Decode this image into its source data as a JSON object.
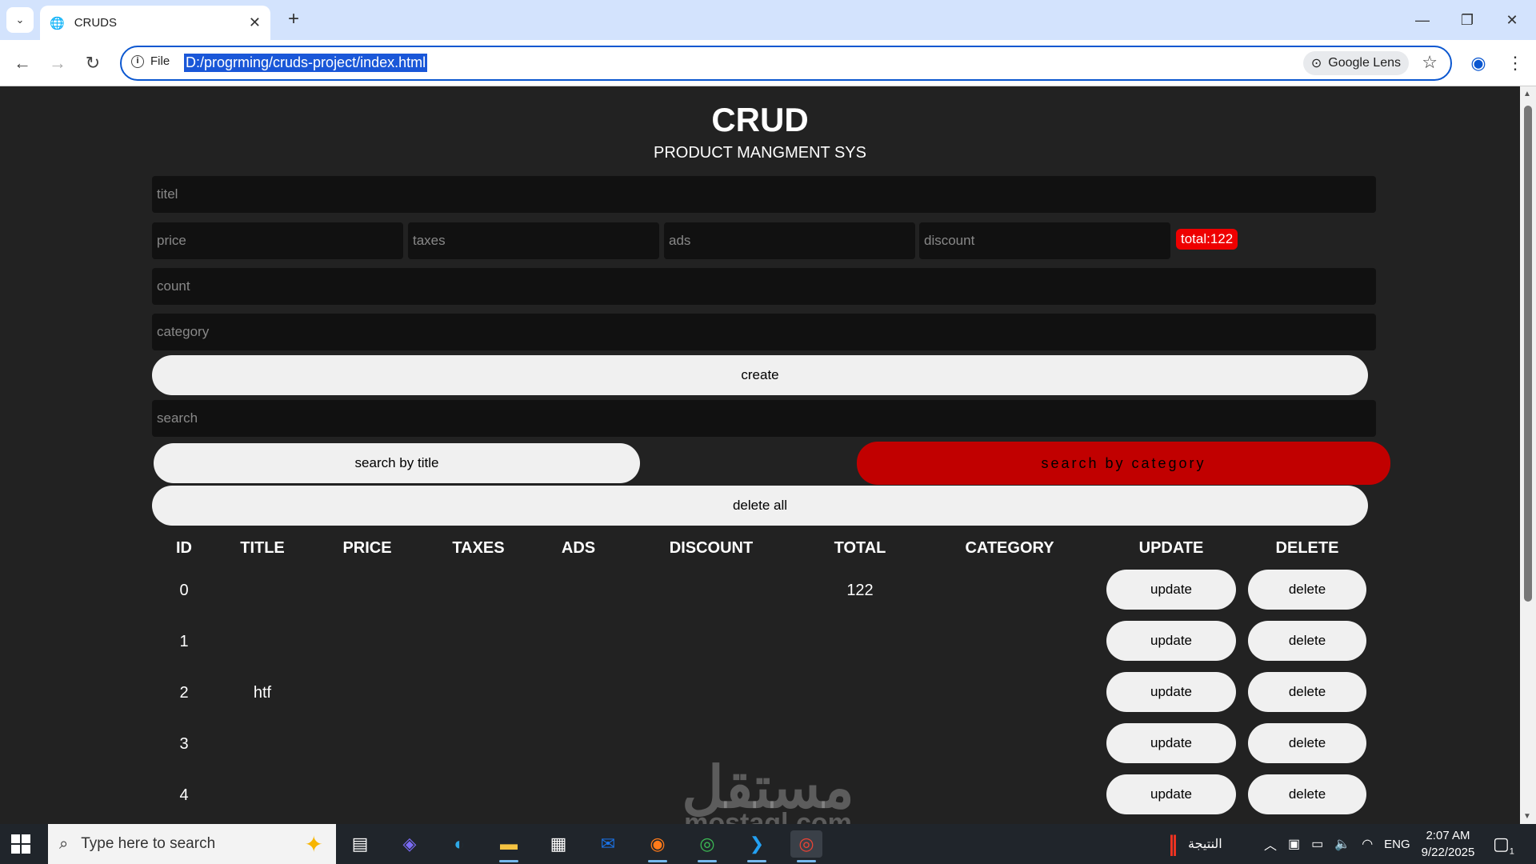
{
  "browser": {
    "tab_title": "CRUDS",
    "url": "D:/progrming/cruds-project/index.html",
    "site_info_label": "File",
    "lens_label": "Google Lens",
    "new_tab": "+",
    "tab_close": "✕",
    "minimize": "—",
    "restore": "❐",
    "close": "✕"
  },
  "page": {
    "title": "CRUD",
    "subtitle": "PRODUCT MANGMENT SYS",
    "inputs": {
      "title_placeholder": "titel",
      "price_placeholder": "price",
      "taxes_placeholder": "taxes",
      "ads_placeholder": "ads",
      "discount_placeholder": "discount",
      "count_placeholder": "count",
      "category_placeholder": "category",
      "search_placeholder": "search"
    },
    "total_badge": "total:122",
    "buttons": {
      "create": "create",
      "search_by_title": "search by title",
      "search_by_category": "search by category",
      "delete_all": "delete all"
    },
    "table": {
      "headers": [
        "ID",
        "TITLE",
        "PRICE",
        "TAXES",
        "ADS",
        "DISCOUNT",
        "TOTAL",
        "CATEGORY",
        "UPDATE",
        "DELETE"
      ],
      "rows": [
        {
          "id": "0",
          "title": "",
          "price": "",
          "taxes": "",
          "ads": "",
          "discount": "",
          "total": "122",
          "category": ""
        },
        {
          "id": "1",
          "title": "",
          "price": "",
          "taxes": "",
          "ads": "",
          "discount": "",
          "total": "",
          "category": ""
        },
        {
          "id": "2",
          "title": "htf",
          "price": "",
          "taxes": "",
          "ads": "",
          "discount": "",
          "total": "",
          "category": ""
        },
        {
          "id": "3",
          "title": "",
          "price": "",
          "taxes": "",
          "ads": "",
          "discount": "",
          "total": "",
          "category": ""
        },
        {
          "id": "4",
          "title": "",
          "price": "",
          "taxes": "",
          "ads": "",
          "discount": "",
          "total": "",
          "category": ""
        }
      ],
      "update_label": "update",
      "delete_label": "delete"
    },
    "watermark": "مستقل",
    "watermark_sub": "mostaql.com"
  },
  "taskbar": {
    "search_placeholder": "Type here to search",
    "tray_app_label": "النتيجة",
    "language": "ENG",
    "time": "2:07 AM",
    "date": "9/22/2025",
    "notification_count": "1"
  },
  "colors": {
    "accent": "#0b57d0",
    "badge_red": "#ee0000",
    "category_button": "#c10000",
    "page_bg": "#222222"
  }
}
